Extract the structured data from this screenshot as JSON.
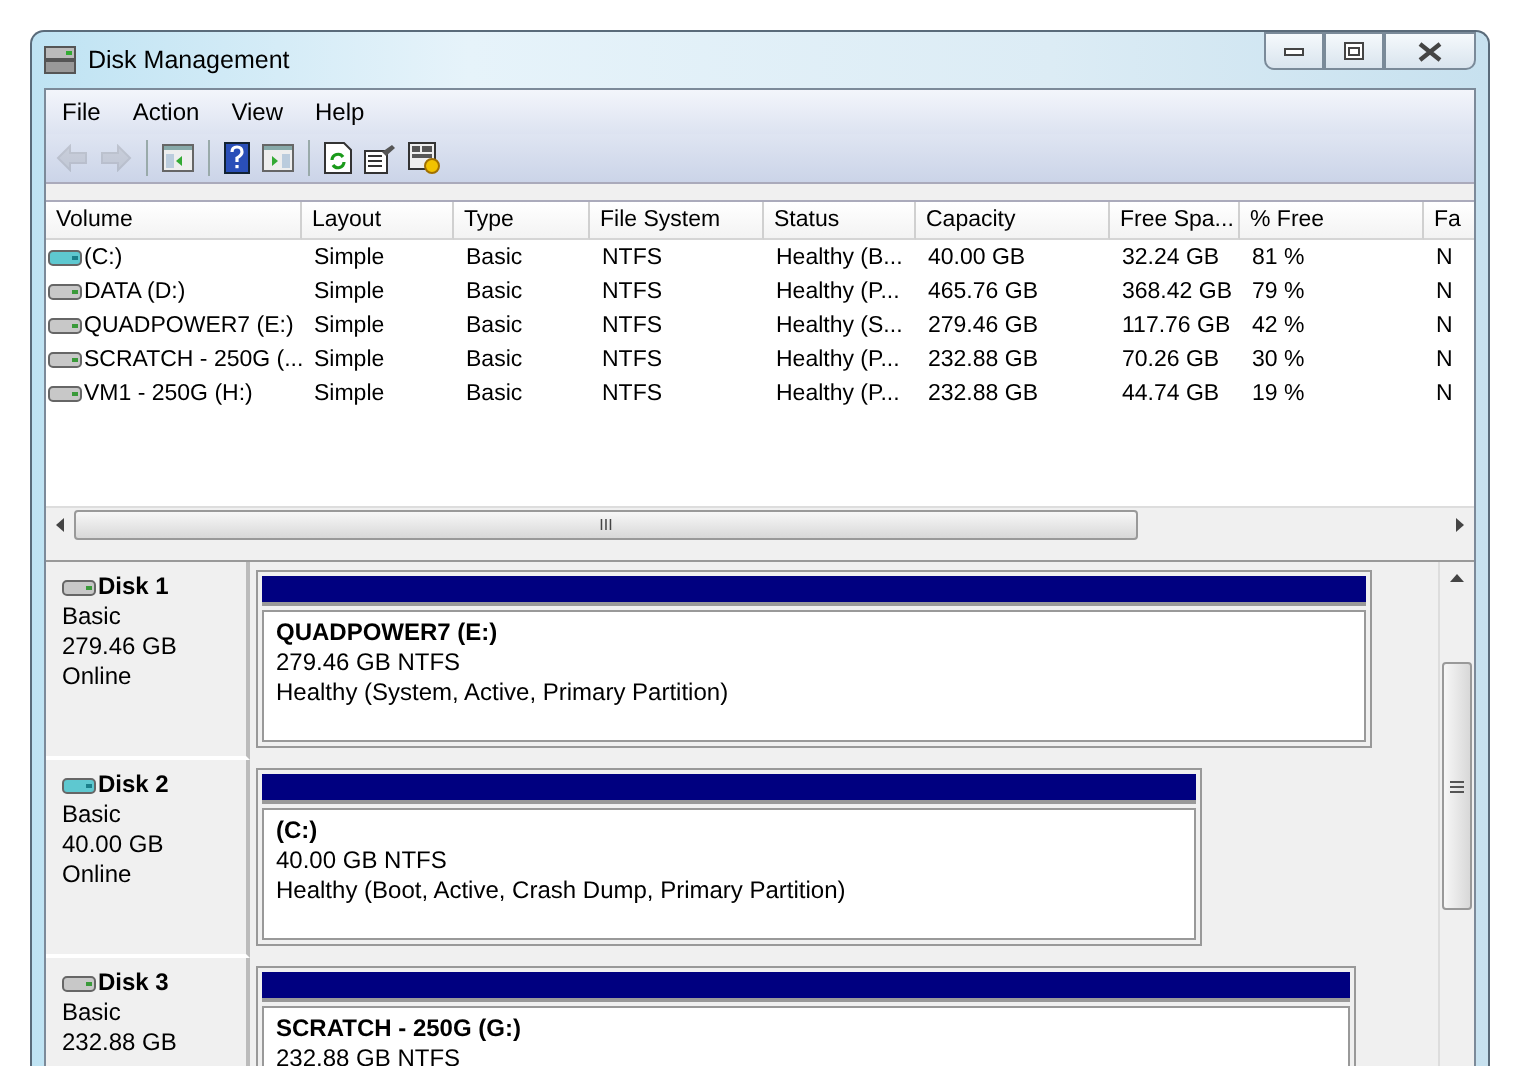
{
  "window": {
    "title": "Disk Management"
  },
  "menu": [
    "File",
    "Action",
    "View",
    "Help"
  ],
  "toolbar": [
    {
      "kind": "back",
      "disabled": true
    },
    {
      "kind": "forward",
      "disabled": true
    },
    {
      "kind": "separator",
      "disabled": false
    },
    {
      "kind": "tree",
      "disabled": false
    },
    {
      "kind": "separator",
      "disabled": false
    },
    {
      "kind": "help",
      "disabled": false
    },
    {
      "kind": "pane",
      "disabled": false
    },
    {
      "kind": "separator",
      "disabled": false
    },
    {
      "kind": "refresh",
      "disabled": false
    },
    {
      "kind": "properties",
      "disabled": false
    },
    {
      "kind": "settings",
      "disabled": false
    }
  ],
  "volumes": {
    "columns": [
      "Volume",
      "Layout",
      "Type",
      "File System",
      "Status",
      "Capacity",
      "Free Spa...",
      "% Free",
      "Fa"
    ],
    "rows": [
      {
        "kind": "system",
        "cells": [
          " (C:)",
          "Simple",
          "Basic",
          "NTFS",
          "Healthy (B...",
          "40.00 GB",
          "32.24 GB",
          "81 %",
          "N"
        ]
      },
      {
        "kind": "data",
        "cells": [
          "DATA (D:)",
          "Simple",
          "Basic",
          "NTFS",
          "Healthy (P...",
          "465.76 GB",
          "368.42 GB",
          "79 %",
          "N"
        ]
      },
      {
        "kind": "data",
        "cells": [
          "QUADPOWER7 (E:)",
          "Simple",
          "Basic",
          "NTFS",
          "Healthy (S...",
          "279.46 GB",
          "117.76 GB",
          "42 %",
          "N"
        ]
      },
      {
        "kind": "data",
        "cells": [
          "SCRATCH - 250G (...",
          "Simple",
          "Basic",
          "NTFS",
          "Healthy (P...",
          "232.88 GB",
          "70.26 GB",
          "30 %",
          "N"
        ]
      },
      {
        "kind": "data",
        "cells": [
          "VM1 - 250G (H:)",
          "Simple",
          "Basic",
          "NTFS",
          "Healthy (P...",
          "232.88 GB",
          "44.74 GB",
          "19 %",
          "N"
        ]
      }
    ],
    "scroll_thumb": "III"
  },
  "disks": [
    {
      "name": "Disk 1",
      "kind": "data",
      "type": "Basic",
      "size": "279.46 GB",
      "status": "Online",
      "partitions": [
        {
          "name": "QUADPOWER7  (E:)",
          "size": "279.46 GB NTFS",
          "status": "Healthy (System, Active, Primary Partition)"
        }
      ]
    },
    {
      "name": "Disk 2",
      "kind": "system",
      "type": "Basic",
      "size": "40.00 GB",
      "status": "Online",
      "partitions": [
        {
          "name": " (C:)",
          "size": "40.00 GB NTFS",
          "status": "Healthy (Boot, Active, Crash Dump, Primary Partition)"
        }
      ]
    },
    {
      "name": "Disk 3",
      "kind": "data",
      "type": "Basic",
      "size": "232.88 GB",
      "partitions": [
        {
          "name": "SCRATCH - 250G  (G:)",
          "size": "232.88 GB NTFS"
        }
      ]
    }
  ]
}
